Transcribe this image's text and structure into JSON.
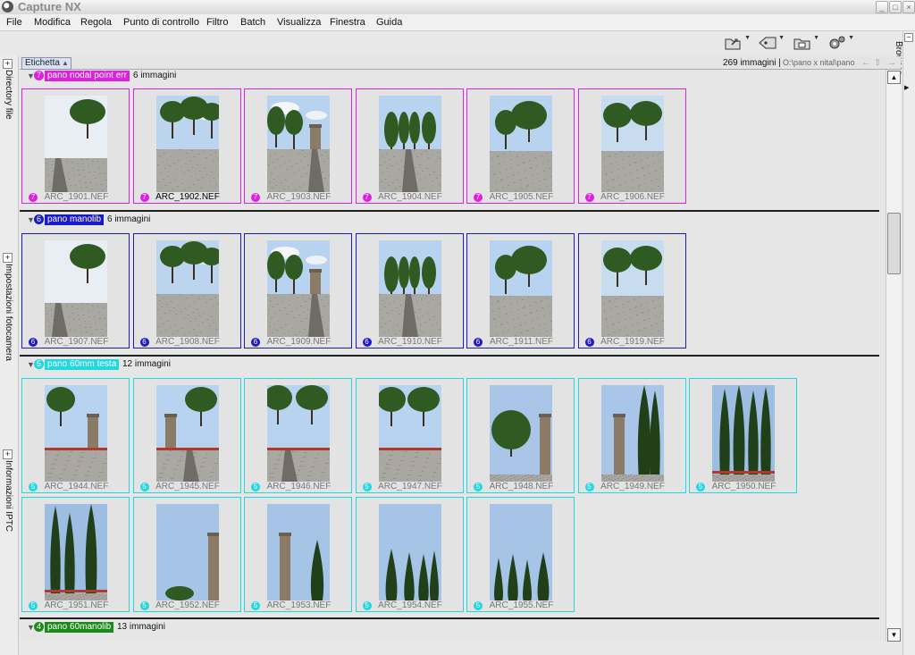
{
  "window": {
    "title": "Capture NX",
    "minimize": "_",
    "maximize": "□",
    "close": "×"
  },
  "menu": [
    "File",
    "Modifica",
    "Regola",
    "Punto di controllo",
    "Filtro",
    "Batch",
    "Visualizza",
    "Finestra",
    "Guida"
  ],
  "toolbar": {
    "icons": [
      "open-folder-icon",
      "label-tag-icon",
      "browse-folder-icon",
      "settings-gears-icon"
    ]
  },
  "left_panels": [
    "Directory file",
    "Impostazioni fotocamera",
    "Informazioni IPTC"
  ],
  "right_panel": {
    "label": "Browser"
  },
  "browser": {
    "sort_label": "Etichetta",
    "sort_arrow": "▲",
    "count": "269 immagini |",
    "path": "O:\\pano x nital\\pano",
    "nav_back": "←",
    "nav_up": "⇧",
    "nav_fwd": "→"
  },
  "colors": {
    "label7": "#e020e0",
    "label6": "#1a1ac8",
    "label5": "#22d8e0",
    "label4": "#1a8a1a"
  },
  "groups": [
    {
      "id": "g7",
      "number": "7",
      "name": "pano nodal point err",
      "count": "6 immagini",
      "files": [
        "ARC_1901.NEF",
        "ARC_1902.NEF",
        "ARC_1903.NEF",
        "ARC_1904.NEF",
        "ARC_1905.NEF",
        "ARC_1906.NEF"
      ]
    },
    {
      "id": "g6",
      "number": "6",
      "name": "pano manolib",
      "count": "6 immagini",
      "files": [
        "ARC_1907.NEF",
        "ARC_1908.NEF",
        "ARC_1909.NEF",
        "ARC_1910.NEF",
        "ARC_1911.NEF",
        "ARC_1919.NEF"
      ]
    },
    {
      "id": "g5",
      "number": "5",
      "name": "pano 60mm testa",
      "count": "12 immagini",
      "files": [
        "ARC_1944.NEF",
        "ARC_1945.NEF",
        "ARC_1946.NEF",
        "ARC_1947.NEF",
        "ARC_1948.NEF",
        "ARC_1949.NEF",
        "ARC_1950.NEF",
        "ARC_1951.NEF",
        "ARC_1952.NEF",
        "ARC_1953.NEF",
        "ARC_1954.NEF",
        "ARC_1955.NEF"
      ]
    },
    {
      "id": "g4",
      "number": "4",
      "name": "pano 60manolib",
      "count": "13 immagini",
      "files": []
    }
  ],
  "selected_file": "ARC_1902.NEF",
  "scrollbar": {
    "up": "▲",
    "down": "▼"
  }
}
